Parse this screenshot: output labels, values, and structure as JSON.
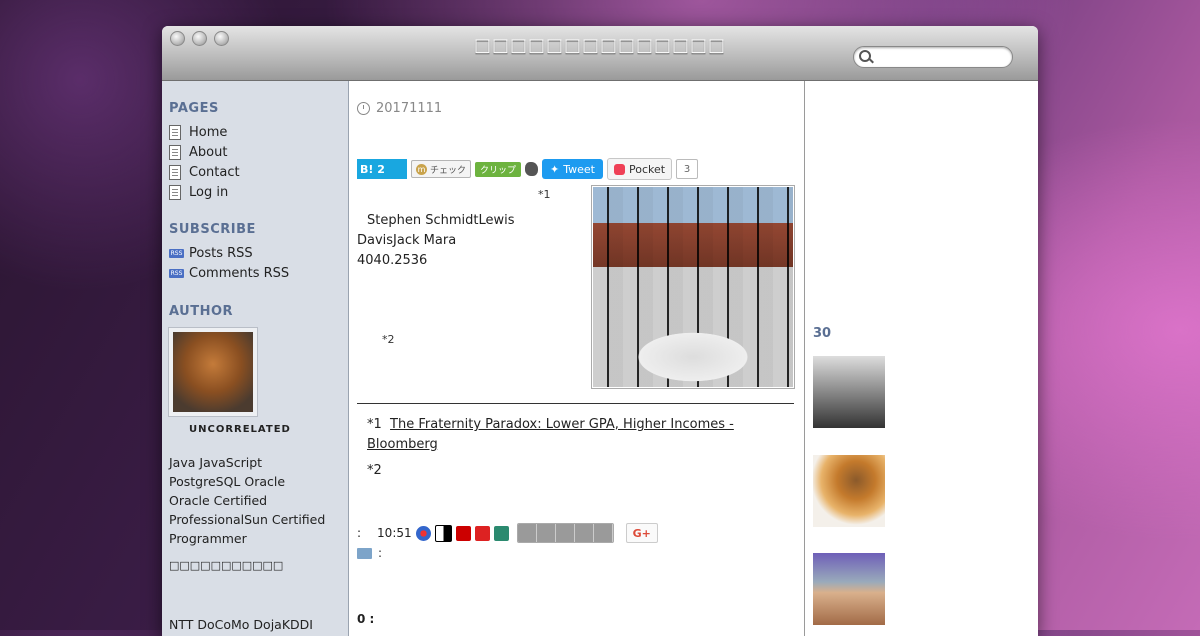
{
  "window": {
    "title": "□□□□□□□□□□□□□□",
    "search_placeholder": ""
  },
  "sidebar": {
    "pages_heading": "PAGES",
    "pages": [
      "Home",
      "About",
      "Contact",
      "Log in"
    ],
    "subscribe_heading": "SUBSCRIBE",
    "subscribe": [
      {
        "icon": "rss-icon",
        "label": "Posts RSS"
      },
      {
        "icon": "rss-icon",
        "label": "Comments RSS"
      }
    ],
    "author_heading": "AUTHOR",
    "author_name": "UNCORRELATED",
    "bio_lines": [
      "Java JavaScript",
      "PostgreSQL Oracle",
      "Oracle Certified",
      "ProfessionalSun Certified",
      "Programmer"
    ],
    "bio_jp": "□□□□□□□□□□□",
    "bio_extra": "NTT DoCoMo DojaKDDI"
  },
  "post": {
    "date": "20171111",
    "share": {
      "hatena_count": "2",
      "check_label": "チェック",
      "clip_label": "クリップ",
      "tweet_label": "Tweet",
      "pocket_label": "Pocket",
      "pocket_count": "3"
    },
    "footnote_ref_1": "*1",
    "body_lines": [
      "Stephen SchmidtLewis",
      "DavisJack Mara",
      "4040.2536"
    ],
    "footnote_ref_2": "*2",
    "footnotes": {
      "n1_label": "*1",
      "n1_link": "The Fraternity Paradox: Lower GPA, Higher Incomes - Bloomberg",
      "n2_label": "*2"
    },
    "meta_prefix": ":",
    "time": "10:51",
    "category_sep": ":",
    "comments": "0 :"
  },
  "right": {
    "heading": "30"
  },
  "colors": {
    "heading": "#5a6f93",
    "sidebar_bg": "#d9dee6",
    "hatena": "#19a7e0",
    "twitter": "#1d9bf0",
    "pocket": "#ef4056"
  }
}
